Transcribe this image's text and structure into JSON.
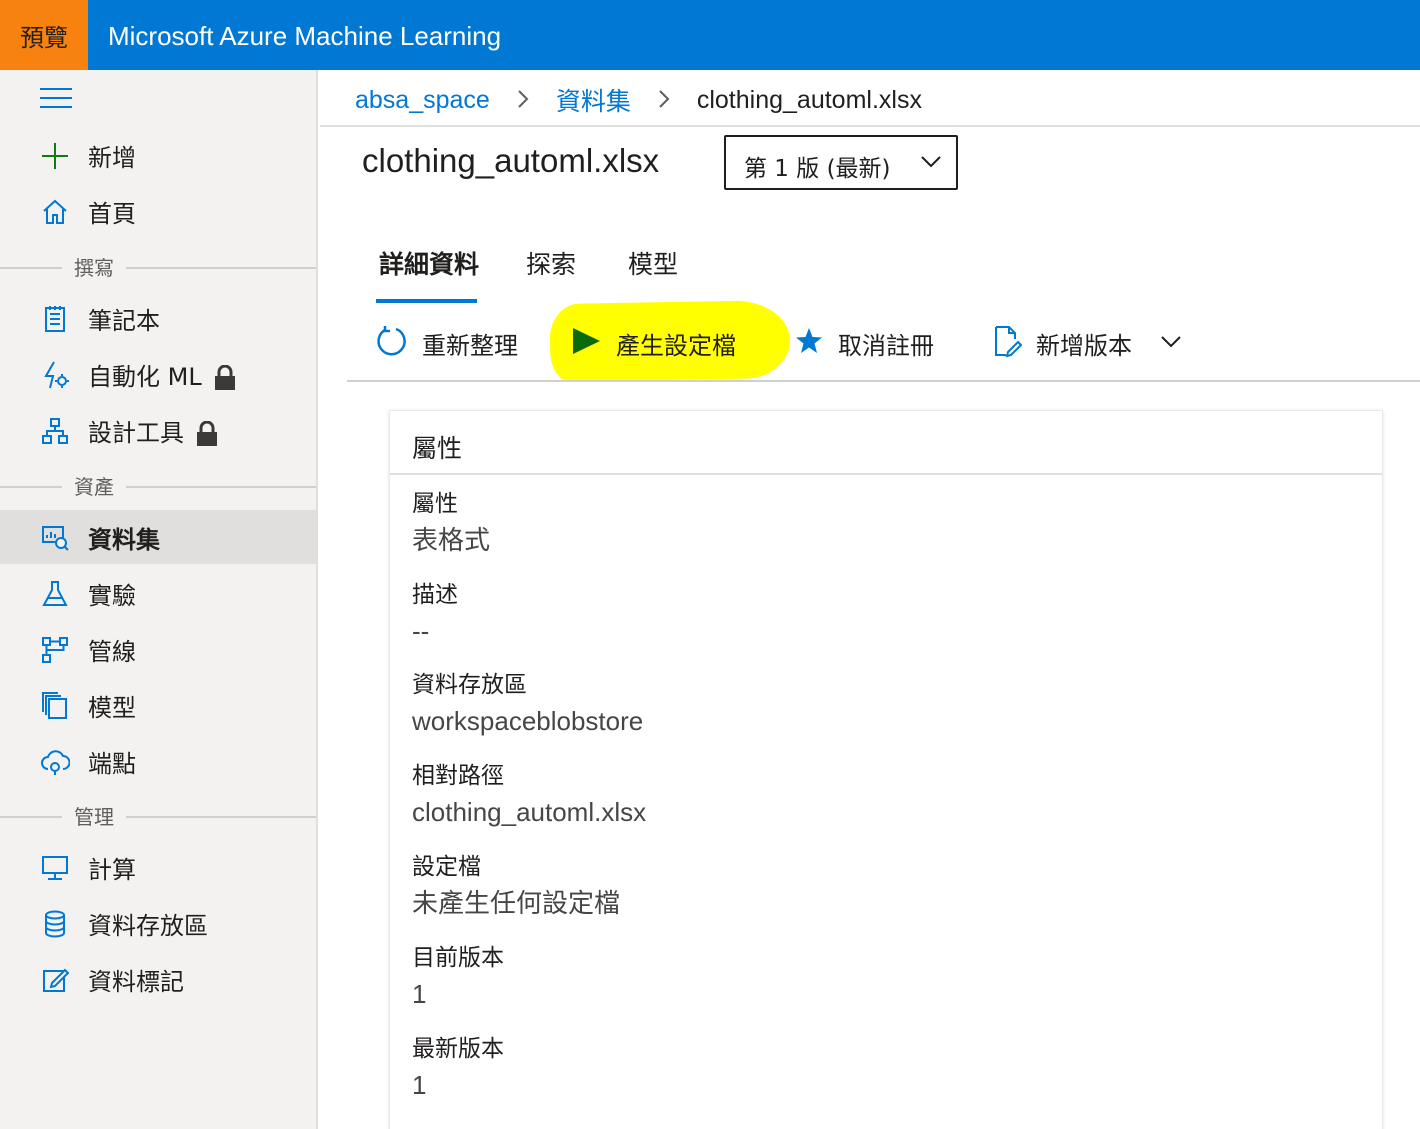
{
  "header": {
    "preview_badge": "預覽",
    "app_title": "Microsoft Azure Machine Learning",
    "brand_color": "#0078d4",
    "badge_color": "#f7820f"
  },
  "sidebar": {
    "menu_icon": "hamburger-icon",
    "items": [
      {
        "label": "新增",
        "icon": "plus-icon"
      },
      {
        "label": "首頁",
        "icon": "home-icon"
      }
    ],
    "sections": [
      {
        "label": "撰寫",
        "items": [
          {
            "label": "筆記本",
            "icon": "notebook-icon"
          },
          {
            "label": "自動化 ML",
            "icon": "automl-icon",
            "locked": true
          },
          {
            "label": "設計工具",
            "icon": "designer-icon",
            "locked": true
          }
        ]
      },
      {
        "label": "資產",
        "items": [
          {
            "label": "資料集",
            "icon": "dataset-icon",
            "active": true
          },
          {
            "label": "實驗",
            "icon": "flask-icon"
          },
          {
            "label": "管線",
            "icon": "pipeline-icon"
          },
          {
            "label": "模型",
            "icon": "model-icon"
          },
          {
            "label": "端點",
            "icon": "endpoint-icon"
          }
        ]
      },
      {
        "label": "管理",
        "items": [
          {
            "label": "計算",
            "icon": "compute-icon"
          },
          {
            "label": "資料存放區",
            "icon": "datastore-icon"
          },
          {
            "label": "資料標記",
            "icon": "labeling-icon"
          }
        ]
      }
    ]
  },
  "breadcrumb": {
    "workspace": "absa_space",
    "section": "資料集",
    "current": "clothing_automl.xlsx",
    "separator": ">"
  },
  "page": {
    "title": "clothing_automl.xlsx",
    "version_select": "第 1 版 (最新)"
  },
  "tabs": [
    "詳細資料",
    "探索",
    "模型"
  ],
  "active_tab": "詳細資料",
  "toolbar": {
    "refresh": "重新整理",
    "generate_profile": "產生設定檔",
    "unregister": "取消註冊",
    "new_version": "新增版本",
    "highlight_color": "#ffff00"
  },
  "properties": {
    "card_title": "屬性",
    "rows": [
      {
        "label": "屬性",
        "value": "表格式"
      },
      {
        "label": "描述",
        "value": "--"
      },
      {
        "label": "資料存放區",
        "value": "workspaceblobstore"
      },
      {
        "label": "相對路徑",
        "value": "clothing_automl.xlsx"
      },
      {
        "label": "設定檔",
        "value": "未產生任何設定檔"
      },
      {
        "label": "目前版本",
        "value": "1"
      },
      {
        "label": "最新版本",
        "value": "1"
      }
    ]
  }
}
